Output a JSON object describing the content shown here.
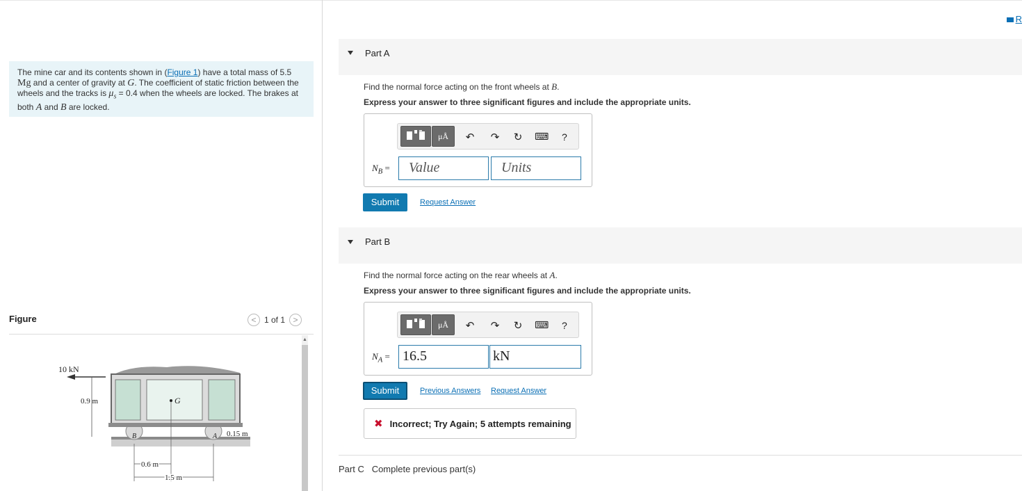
{
  "top_right_link": "R",
  "problem": {
    "text_1": "The mine car and its contents shown in (",
    "figure_link": "Figure 1",
    "text_2": ") have a total mass of 5.5 ",
    "mass_unit": "Mg",
    "text_3": " and a center of gravity at ",
    "g": "G",
    "text_4": ". The coefficient of static friction between the wheels and the tracks is ",
    "mu": "μ",
    "mu_sub": "s",
    "text_5": " = 0.4 when the wheels are locked. The brakes at both ",
    "a": "A",
    "text_6": " and ",
    "b": "B",
    "text_7": " are locked."
  },
  "figure": {
    "label": "Figure",
    "pager": "1 of 1",
    "prev": "<",
    "next": ">",
    "diagram": {
      "force": "10 kN",
      "height_cg": "0.9 m",
      "g_label": "G",
      "b_label": "B",
      "a_label": "A",
      "wheel_radius": "0.15 m",
      "dim_1": "0.6 m",
      "dim_2": "1.5 m"
    }
  },
  "part_a": {
    "title": "Part A",
    "find_prefix": "Find the normal force acting on the front wheels at ",
    "find_var": "B",
    "find_suffix": ".",
    "express": "Express your answer to three significant figures and include the appropriate units.",
    "toolbar": {
      "units_btn": "μÅ",
      "undo": "↶",
      "redo": "↷",
      "reset": "↻",
      "keyboard": "⌨",
      "help": "?"
    },
    "var_main": "N",
    "var_sub": "B",
    "equals": "=",
    "value_placeholder": "Value",
    "units_placeholder": "Units",
    "submit": "Submit",
    "request_answer": "Request Answer"
  },
  "part_b": {
    "title": "Part B",
    "find_prefix": "Find the normal force acting on the rear wheels at ",
    "find_var": "A",
    "find_suffix": ".",
    "express": "Express your answer to three significant figures and include the appropriate units.",
    "toolbar": {
      "units_btn": "μÅ",
      "undo": "↶",
      "redo": "↷",
      "reset": "↻",
      "keyboard": "⌨",
      "help": "?"
    },
    "var_main": "N",
    "var_sub": "A",
    "equals": "=",
    "value": "16.5",
    "units": "kN",
    "submit": "Submit",
    "previous_answers": "Previous Answers",
    "request_answer": "Request Answer",
    "feedback_icon": "✖",
    "feedback": "Incorrect; Try Again; 5 attempts remaining"
  },
  "part_c": {
    "title": "Part C",
    "status": "Complete previous part(s)"
  },
  "colors": {
    "accent": "#117ab0",
    "problem_bg": "#e8f4f8",
    "error": "#c8102e"
  }
}
